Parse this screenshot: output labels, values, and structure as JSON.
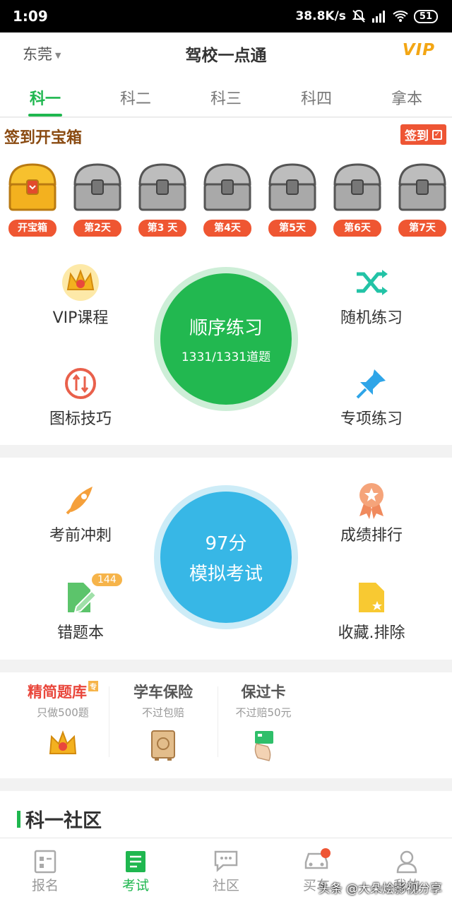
{
  "status": {
    "time": "1:09",
    "speed": "38.8K/s",
    "battery": "51"
  },
  "header": {
    "city": "东莞",
    "title": "驾校一点通",
    "vip": "VIP"
  },
  "tabs": [
    "科一",
    "科二",
    "科三",
    "科四",
    "拿本"
  ],
  "treasure": {
    "title": "签到开宝箱",
    "sign_label": "签到",
    "chests": [
      "开宝箱",
      "第2天",
      "第3 天",
      "第4天",
      "第5天",
      "第6天",
      "第7天"
    ]
  },
  "practice": {
    "vip_course": "VIP课程",
    "sequential": {
      "title": "顺序练习",
      "progress": "1331/1331道题"
    },
    "random": "随机练习",
    "icon_tips": "图标技巧",
    "special": "专项练习"
  },
  "exam": {
    "sprint": "考前冲刺",
    "ranking": "成绩排行",
    "mock": {
      "score": "97分",
      "title": "模拟考试"
    },
    "wrong_book": "错题本",
    "wrong_count": "144",
    "favorites": "收藏.排除"
  },
  "products": [
    {
      "title": "精简题库",
      "sub": "只做500题",
      "tag": "专"
    },
    {
      "title": "学车保险",
      "sub": "不过包赔"
    },
    {
      "title": "保过卡",
      "sub": "不过赔50元"
    }
  ],
  "community": {
    "title": "科一社区"
  },
  "nav": [
    "报名",
    "考试",
    "社区",
    "买车",
    "我的"
  ],
  "watermark": "头条 @大朵烩影视分享",
  "colors": {
    "green": "#1fb74f",
    "blue": "#37b7e6",
    "orange": "#ef5632",
    "gold": "#f3a614"
  }
}
